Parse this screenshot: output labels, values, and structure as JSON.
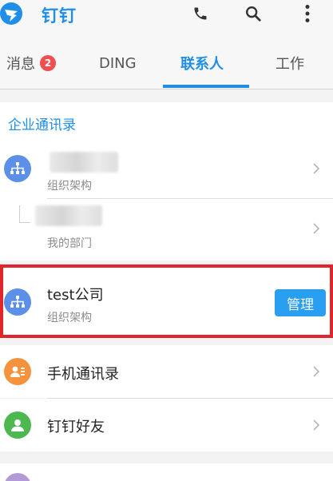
{
  "header": {
    "app_title": "钉钉",
    "icons": [
      "dingtalk-logo-icon",
      "phone-icon",
      "search-icon",
      "more-vert-icon"
    ]
  },
  "tabs": [
    {
      "label": "消息",
      "badge": "2"
    },
    {
      "label": "DING"
    },
    {
      "label": "联系人",
      "active": true
    },
    {
      "label": "工作"
    }
  ],
  "enterprise": {
    "section_title": "企业通讯录",
    "org_row": {
      "subtitle": "组织架构"
    },
    "dept_row": {
      "subtitle": "我的部门"
    }
  },
  "company": {
    "name": "test公司",
    "subtitle": "组织架构",
    "manage_label": "管理"
  },
  "contacts": {
    "phone_contacts": "手机通讯录",
    "friends": "钉钉好友"
  },
  "colors": {
    "accent": "#1f8ee8",
    "badge": "#f04f4f",
    "highlight_border": "#e0262b",
    "org_icon": "#5b8fe8",
    "phone_icon": "#f5923e",
    "friend_icon": "#4cb84f"
  }
}
